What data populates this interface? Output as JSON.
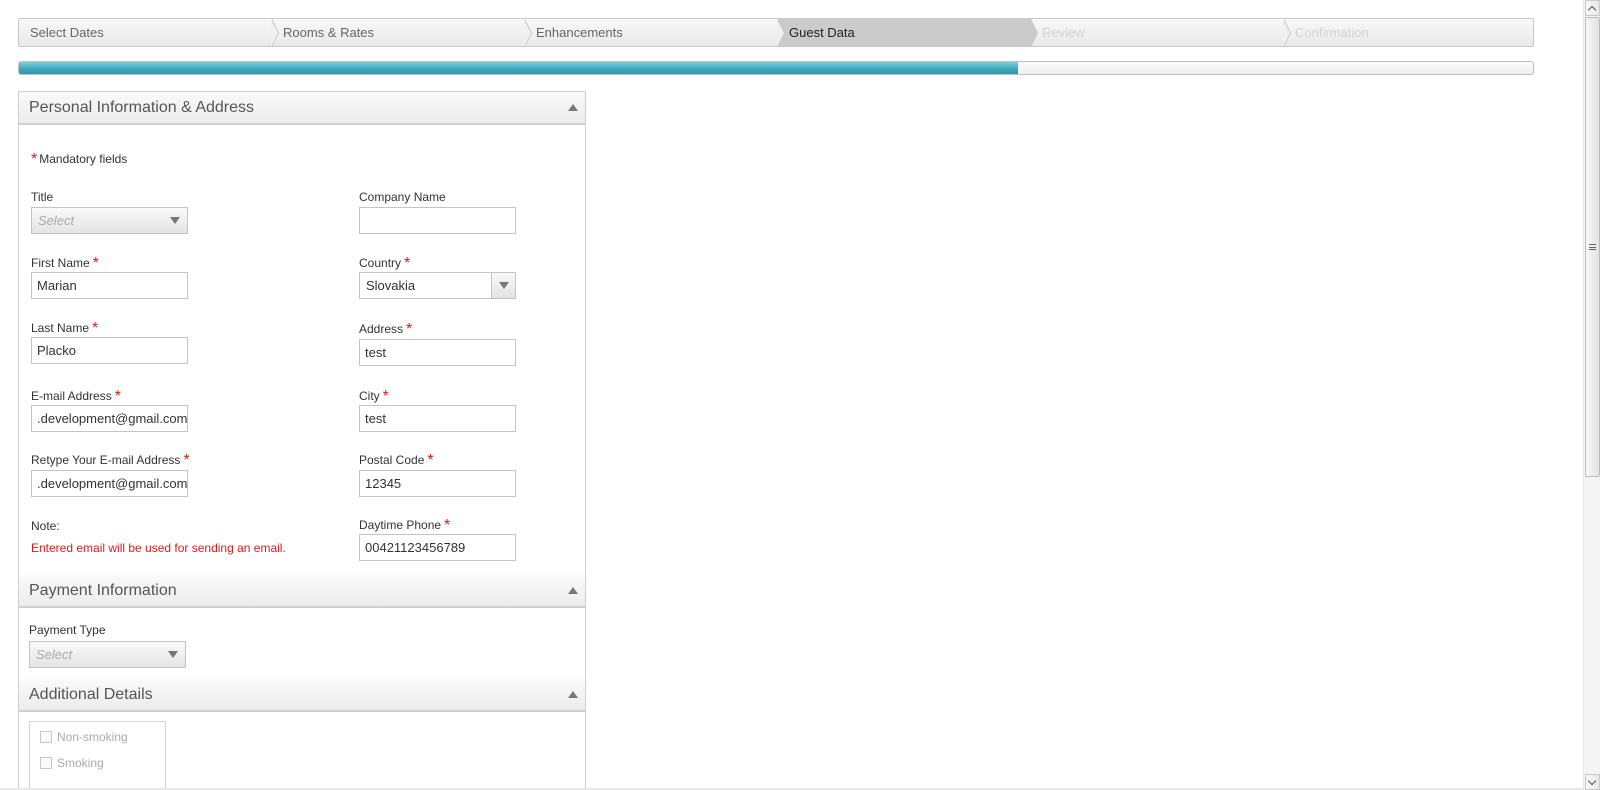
{
  "steps": [
    {
      "label": "Select Dates",
      "state": "done"
    },
    {
      "label": "Rooms & Rates",
      "state": "done"
    },
    {
      "label": "Enhancements",
      "state": "done"
    },
    {
      "label": "Guest Data",
      "state": "active"
    },
    {
      "label": "Review",
      "state": "disabled"
    },
    {
      "label": "Confirmation",
      "state": "disabled"
    }
  ],
  "progress": {
    "percent": 66
  },
  "personal": {
    "title": "Personal Information & Address",
    "mandatory_star": "*",
    "mandatory_label": "Mandatory fields",
    "title_label": "Title",
    "title_placeholder": "Select",
    "company_label": "Company Name",
    "company_value": "",
    "first_name_label": "First Name",
    "first_name_value": "Marian",
    "country_label": "Country",
    "country_value": "Slovakia",
    "last_name_label": "Last Name",
    "last_name_value": "Placko",
    "address_label": "Address",
    "address_value": "test",
    "email_label": "E-mail Address",
    "email_value": ".development@gmail.com",
    "city_label": "City",
    "city_value": "test",
    "retype_email_label": "Retype Your E-mail Address",
    "retype_email_value": ".development@gmail.com",
    "postal_label": "Postal Code",
    "postal_value": "12345",
    "note_label": "Note:",
    "note_text": "Entered email will be used for sending an email.",
    "phone_label": "Daytime Phone",
    "phone_value": "00421123456789",
    "required_mark": "*"
  },
  "payment": {
    "title": "Payment Information",
    "type_label": "Payment Type",
    "type_placeholder": "Select"
  },
  "additional": {
    "title": "Additional Details",
    "options": [
      "Non-smoking",
      "Smoking"
    ]
  },
  "colors": {
    "accent": "#3ea9bb",
    "required": "#e31919"
  }
}
